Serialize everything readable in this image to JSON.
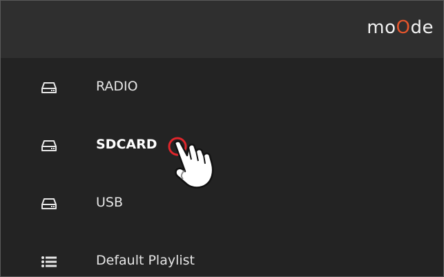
{
  "app": {
    "logo_parts": [
      "mo",
      "O",
      "de"
    ],
    "accent_color": "#e4552c"
  },
  "menu": {
    "items": [
      {
        "label": "RADIO",
        "icon": "drive-icon",
        "active": false
      },
      {
        "label": "SDCARD",
        "icon": "drive-icon",
        "active": true
      },
      {
        "label": "USB",
        "icon": "drive-icon",
        "active": false
      },
      {
        "label": "Default Playlist",
        "icon": "playlist-icon",
        "active": false
      }
    ]
  },
  "pointer": {
    "icon": "hand-pointer-icon",
    "target": "SDCARD"
  }
}
